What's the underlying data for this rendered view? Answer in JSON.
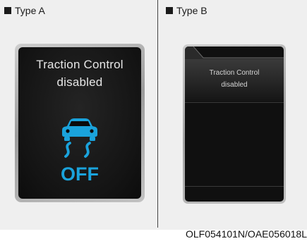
{
  "type_a": {
    "label": "Type A",
    "message_line1": "Traction Control",
    "message_line2": "disabled",
    "icon": "traction-control-off-icon",
    "icon_text": "OFF",
    "icon_color": "#1aa3dc"
  },
  "type_b": {
    "label": "Type B",
    "message_line1": "Traction Control",
    "message_line2": "disabled"
  },
  "reference_code": "OLF054101N/OAE056018L"
}
